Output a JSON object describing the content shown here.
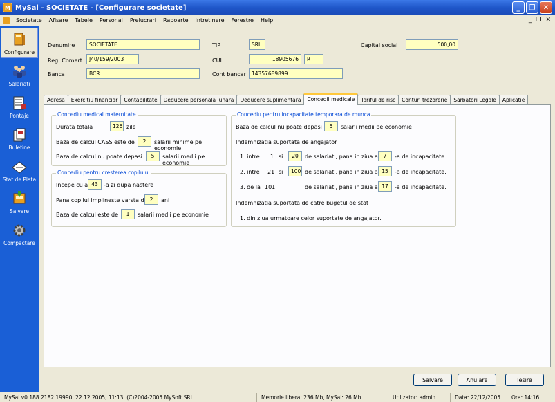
{
  "window": {
    "title": "MySal - SOCIETATE - [Configurare societate]",
    "app_icon": "M"
  },
  "menu": [
    "Societate",
    "Afisare",
    "Tabele",
    "Personal",
    "Prelucrari",
    "Rapoarte",
    "Intretinere",
    "Ferestre",
    "Help"
  ],
  "window_buttons": {
    "minimize": "_",
    "restore": "❐",
    "close": "✕"
  },
  "mdi_buttons": {
    "minimize": "_",
    "restore": "❐",
    "close": "✕"
  },
  "sidebar": [
    {
      "label": "Configurare",
      "icon": "book-icon",
      "active": true
    },
    {
      "label": "Salariati",
      "icon": "people-icon",
      "active": false
    },
    {
      "label": "Pontaje",
      "icon": "timesheet-icon",
      "active": false
    },
    {
      "label": "Buletine",
      "icon": "bulletin-icon",
      "active": false
    },
    {
      "label": "Stat de Plata",
      "icon": "payroll-icon",
      "active": false
    },
    {
      "label": "Salvare",
      "icon": "save-icon",
      "active": false
    },
    {
      "label": "Compactare",
      "icon": "gear-icon",
      "active": false
    }
  ],
  "company": {
    "denumire_label": "Denumire",
    "denumire": "SOCIETATE",
    "tip_label": "TIP",
    "tip": "SRL",
    "capital_label": "Capital social",
    "capital": "500,00",
    "regcom_label": "Reg. Comert",
    "regcom": "J40/159/2003",
    "cui_label": "CUI",
    "cui": "18905676",
    "cui_suffix": "R",
    "banca_label": "Banca",
    "banca": "BCR",
    "cont_label": "Cont bancar",
    "cont": "14357689899"
  },
  "tabs": [
    {
      "label": "Adresa",
      "active": false
    },
    {
      "label": "Exercitiu financiar",
      "active": false
    },
    {
      "label": "Contabilitate",
      "active": false
    },
    {
      "label": "Deducere personala lunara",
      "active": false
    },
    {
      "label": "Deducere suplimentara",
      "active": false
    },
    {
      "label": "Concedii medicale",
      "active": true
    },
    {
      "label": "Tariful de risc",
      "active": false
    },
    {
      "label": "Conturi trezorerie",
      "active": false
    },
    {
      "label": "Sarbatori Legale",
      "active": false
    },
    {
      "label": "Aplicatie",
      "active": false
    }
  ],
  "maternitate": {
    "title": "Concediu medical maternitate",
    "durata_label": "Durata totala",
    "durata": "126",
    "durata_unit": "zile",
    "cass_label": "Baza de calcul CASS este de",
    "cass": "2",
    "cass_unit": "salarii minime pe economie",
    "baza_label": "Baza de calcul nu poate depasi",
    "baza": "5",
    "baza_unit": "salarii medii pe economie"
  },
  "crestere": {
    "title": "Concediu pentru cresterea copilului",
    "incepe_label": "Incepe cu a",
    "incepe": "43",
    "incepe_unit": "-a zi dupa nastere",
    "varsta_label": "Pana copilul implineste varsta de",
    "varsta": "2",
    "varsta_unit": "ani",
    "baza_label": "Baza de calcul este de",
    "baza": "1",
    "baza_unit": "salarii medii pe economie"
  },
  "incapacitate": {
    "title": "Concediu pentru incapacitate temporara de munca",
    "baza_label": "Baza de calcul nu poate depasi",
    "baza": "5",
    "baza_unit": "salarii medii pe economie",
    "angajator_title": "Indemnizatia suportata de angajator",
    "rows": [
      {
        "prefix": "1. intre",
        "from": "1",
        "si": "si",
        "count": "20",
        "mid": "de salariati, pana in ziua a",
        "day": "7",
        "suffix": "-a de incapacitate."
      },
      {
        "prefix": "2. intre",
        "from": "21",
        "si": "si",
        "count": "100",
        "mid": "de salariati, pana in ziua a",
        "day": "15",
        "suffix": "-a de incapacitate."
      },
      {
        "prefix": "3. de la",
        "from": "101",
        "si": "",
        "count": "",
        "mid": "de salariati, pana in ziua a",
        "day": "17",
        "suffix": "-a de incapacitate."
      }
    ],
    "buget_title": "Indemnizatia suportata de catre bugetul de stat",
    "buget_text": "1. din ziua urmatoare celor suportate de angajator."
  },
  "buttons": {
    "salvare": "Salvare",
    "anulare": "Anulare",
    "iesire": "Iesire"
  },
  "status": {
    "version": "MySal v0.188.2182.19990, 22.12.2005, 11:13, (C)2004-2005 MySoft SRL",
    "memory": "Memorie libera: 236 Mb, MySal: 26 Mb",
    "user": "Utilizator: admin",
    "date": "Data: 22/12/2005",
    "time": "Ora: 14:16"
  }
}
